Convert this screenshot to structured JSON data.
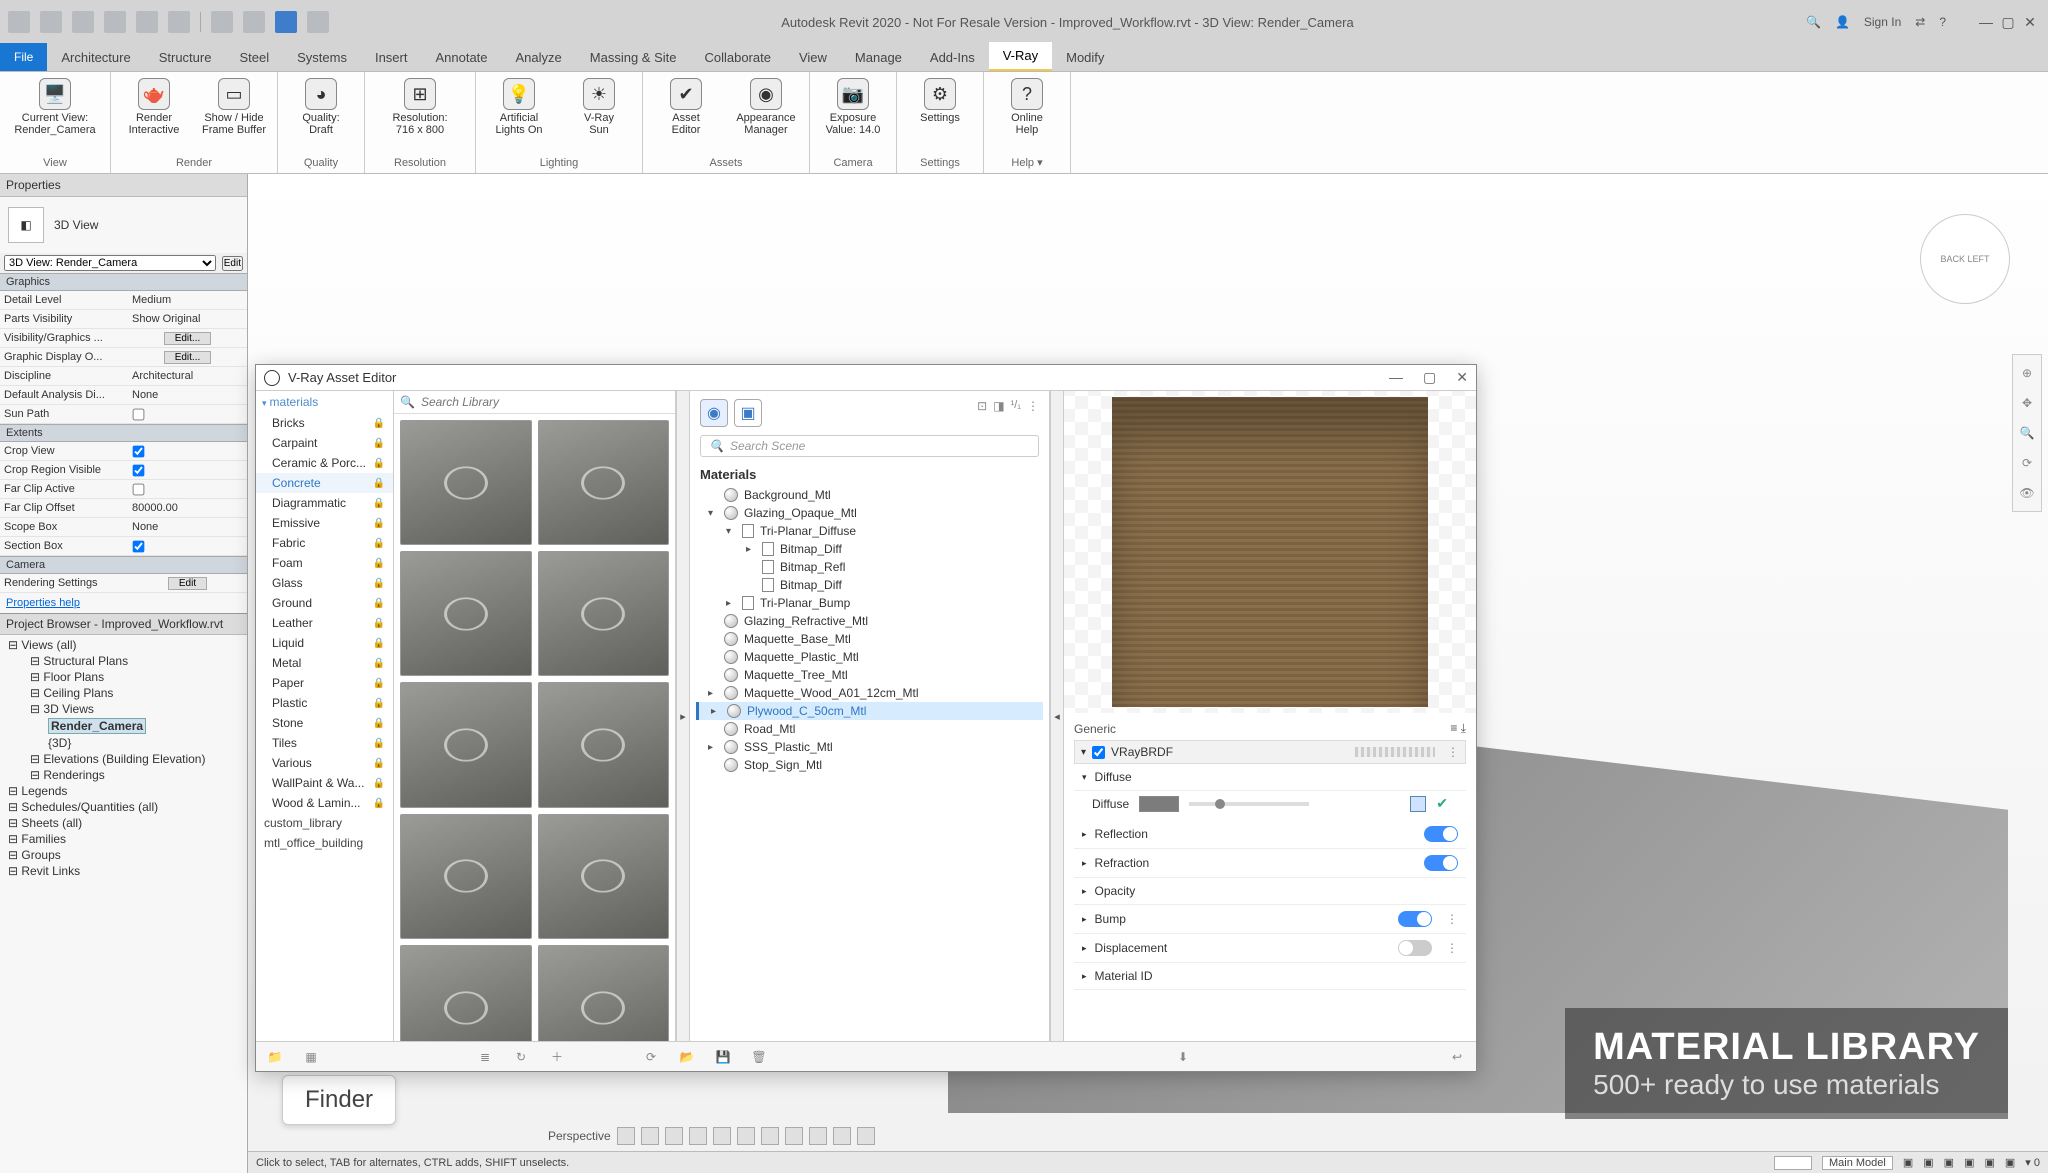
{
  "app": {
    "title": "Autodesk Revit 2020 - Not For Resale Version - Improved_Workflow.rvt - 3D View: Render_Camera",
    "sign_in": "Sign In"
  },
  "ribbon_tabs": [
    "File",
    "Architecture",
    "Structure",
    "Steel",
    "Systems",
    "Insert",
    "Annotate",
    "Analyze",
    "Massing & Site",
    "Collaborate",
    "View",
    "Manage",
    "Add-Ins",
    "V-Ray",
    "Modify"
  ],
  "ribbon_active": "V-Ray",
  "ribbon_groups": {
    "view": {
      "title": "View",
      "btn": [
        "Current View:",
        "Render_Camera"
      ]
    },
    "render": {
      "title": "Render",
      "btns": [
        [
          "Render",
          "Interactive"
        ],
        [
          "Show / Hide",
          "Frame Buffer"
        ]
      ]
    },
    "quality": {
      "title": "Quality",
      "btn": [
        "Quality:",
        "Draft"
      ]
    },
    "resolution": {
      "title": "Resolution",
      "btn": [
        "Resolution:",
        "716 x 800"
      ]
    },
    "lighting": {
      "title": "Lighting",
      "btns": [
        [
          "Artificial",
          "Lights On"
        ],
        [
          "V-Ray",
          "Sun"
        ]
      ]
    },
    "assets": {
      "title": "Assets",
      "btns": [
        [
          "Asset",
          "Editor"
        ],
        [
          "Appearance",
          "Manager"
        ]
      ]
    },
    "camera": {
      "title": "Camera",
      "btn": [
        "Exposure",
        "Value: 14.0"
      ]
    },
    "settings": {
      "title": "Settings",
      "btn": "Settings"
    },
    "help": {
      "title": "Help ▾",
      "btn": [
        "Online",
        "Help"
      ]
    }
  },
  "properties": {
    "header": "Properties",
    "type": "3D View",
    "selector": "3D View: Render_Camera",
    "edit_btn": "Edit",
    "sections": {
      "graphics": {
        "title": "Graphics",
        "rows": [
          {
            "k": "Detail Level",
            "v": "Medium"
          },
          {
            "k": "Parts Visibility",
            "v": "Show Original"
          },
          {
            "k": "Visibility/Graphics ...",
            "v": "Edit..."
          },
          {
            "k": "Graphic Display O...",
            "v": "Edit..."
          },
          {
            "k": "Discipline",
            "v": "Architectural"
          },
          {
            "k": "Default Analysis Di...",
            "v": "None"
          },
          {
            "k": "Sun Path",
            "v": false
          }
        ]
      },
      "extents": {
        "title": "Extents",
        "rows": [
          {
            "k": "Crop View",
            "v": true
          },
          {
            "k": "Crop Region Visible",
            "v": true
          },
          {
            "k": "Far Clip Active",
            "v": false
          },
          {
            "k": "Far Clip Offset",
            "v": "80000.00"
          },
          {
            "k": "Scope Box",
            "v": "None"
          },
          {
            "k": "Section Box",
            "v": true
          }
        ]
      },
      "camera": {
        "title": "Camera",
        "rows": [
          {
            "k": "Rendering Settings",
            "v": "Edit"
          }
        ]
      }
    },
    "help_link": "Properties help"
  },
  "browser": {
    "title": "Project Browser - Improved_Workflow.rvt",
    "nodes": [
      {
        "lvl": 0,
        "label": "Views (all)"
      },
      {
        "lvl": 1,
        "label": "Structural Plans"
      },
      {
        "lvl": 1,
        "label": "Floor Plans"
      },
      {
        "lvl": 1,
        "label": "Ceiling Plans"
      },
      {
        "lvl": 1,
        "label": "3D Views"
      },
      {
        "lvl": 2,
        "label": "Render_Camera",
        "sel": true
      },
      {
        "lvl": 2,
        "label": "{3D}"
      },
      {
        "lvl": 1,
        "label": "Elevations (Building Elevation)"
      },
      {
        "lvl": 1,
        "label": "Renderings"
      },
      {
        "lvl": 0,
        "label": "Legends"
      },
      {
        "lvl": 0,
        "label": "Schedules/Quantities (all)"
      },
      {
        "lvl": 0,
        "label": "Sheets (all)"
      },
      {
        "lvl": 0,
        "label": "Families"
      },
      {
        "lvl": 0,
        "label": "Groups"
      },
      {
        "lvl": 0,
        "label": "Revit Links"
      }
    ]
  },
  "asset_editor": {
    "title": "V-Ray Asset Editor",
    "search_library_ph": "Search Library",
    "search_scene_ph": "Search Scene",
    "scene_header": "Materials",
    "categories_header": "materials",
    "categories": [
      "Bricks",
      "Carpaint",
      "Ceramic & Porc...",
      "Concrete",
      "Diagrammatic",
      "Emissive",
      "Fabric",
      "Foam",
      "Glass",
      "Ground",
      "Leather",
      "Liquid",
      "Metal",
      "Paper",
      "Plastic",
      "Stone",
      "Tiles",
      "Various",
      "WallPaint & Wa...",
      "Wood & Lamin..."
    ],
    "category_selected": "Concrete",
    "extra_folders": [
      "custom_library",
      "mtl_office_building"
    ],
    "scene_materials": [
      {
        "name": "Background_Mtl",
        "lvl": 0,
        "kind": "sphere"
      },
      {
        "name": "Glazing_Opaque_Mtl",
        "lvl": 0,
        "kind": "sphere",
        "exp": "▾"
      },
      {
        "name": "Tri-Planar_Diffuse",
        "lvl": 1,
        "kind": "leaf",
        "exp": "▾"
      },
      {
        "name": "Bitmap_Diff",
        "lvl": 2,
        "kind": "leaf",
        "exp": "▸"
      },
      {
        "name": "Bitmap_Refl",
        "lvl": 2,
        "kind": "leaf"
      },
      {
        "name": "Bitmap_Diff",
        "lvl": 2,
        "kind": "leaf"
      },
      {
        "name": "Tri-Planar_Bump",
        "lvl": 1,
        "kind": "leaf",
        "exp": "▸"
      },
      {
        "name": "Glazing_Refractive_Mtl",
        "lvl": 0,
        "kind": "sphere"
      },
      {
        "name": "Maquette_Base_Mtl",
        "lvl": 0,
        "kind": "sphere"
      },
      {
        "name": "Maquette_Plastic_Mtl",
        "lvl": 0,
        "kind": "sphere"
      },
      {
        "name": "Maquette_Tree_Mtl",
        "lvl": 0,
        "kind": "sphere"
      },
      {
        "name": "Maquette_Wood_A01_12cm_Mtl",
        "lvl": 0,
        "kind": "sphere",
        "exp": "▸"
      },
      {
        "name": "Plywood_C_50cm_Mtl",
        "lvl": 0,
        "kind": "sphere",
        "sel": true,
        "exp": "▸"
      },
      {
        "name": "Road_Mtl",
        "lvl": 0,
        "kind": "sphere"
      },
      {
        "name": "SSS_Plastic_Mtl",
        "lvl": 0,
        "kind": "sphere",
        "exp": "▸"
      },
      {
        "name": "Stop_Sign_Mtl",
        "lvl": 0,
        "kind": "sphere"
      }
    ],
    "attrs": {
      "generic": "Generic",
      "layer": "VRayBRDF",
      "diffuse_section": "Diffuse",
      "diffuse_label": "Diffuse",
      "reflection": "Reflection",
      "refraction": "Refraction",
      "opacity": "Opacity",
      "bump": "Bump",
      "displacement": "Displacement",
      "material_id": "Material ID"
    },
    "preview_hdr_right": "¹/₁"
  },
  "promo": {
    "h": "MATERIAL LIBRARY",
    "s": "500+ ready to use materials"
  },
  "finder": "Finder",
  "view_controls": {
    "label": "Perspective"
  },
  "status": {
    "hint": "Click to select, TAB for alternates, CTRL adds, SHIFT unselects.",
    "model": "Main Model"
  },
  "viewcube": {
    "faces": "BACK  LEFT"
  }
}
